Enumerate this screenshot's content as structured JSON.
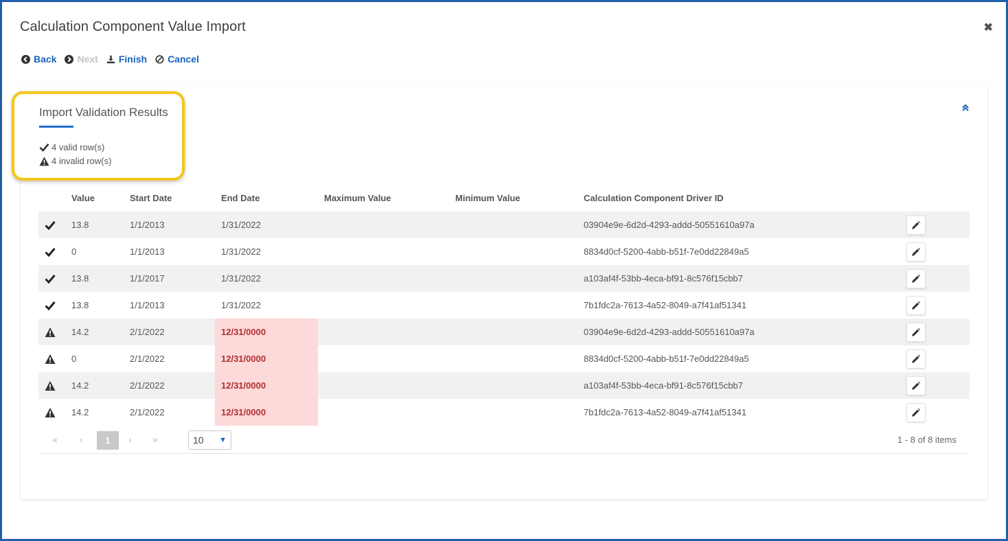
{
  "dialog": {
    "title": "Calculation Component Value Import",
    "close_icon": "close-icon"
  },
  "toolbar": {
    "back_label": "Back",
    "next_label": "Next",
    "finish_label": "Finish",
    "cancel_label": "Cancel"
  },
  "section": {
    "title": "Import Validation Results",
    "valid_rows": "4 valid row(s)",
    "invalid_rows": "4 invalid row(s)"
  },
  "colors": {
    "accent": "#1565c0",
    "frame_border": "#1f5fa8",
    "highlight": "#f3c61a",
    "error_bg": "#fdd9d9",
    "error_text": "#b03030"
  },
  "grid": {
    "columns": [
      "Value",
      "Start Date",
      "End Date",
      "Maximum Value",
      "Minimum Value",
      "Calculation Component Driver ID"
    ],
    "rows": [
      {
        "status": "valid",
        "value": "13.8",
        "start": "1/1/2013",
        "end": "1/31/2022",
        "max": "",
        "min": "",
        "driver": "03904e9e-6d2d-4293-addd-50551610a97a"
      },
      {
        "status": "valid",
        "value": "0",
        "start": "1/1/2013",
        "end": "1/31/2022",
        "max": "",
        "min": "",
        "driver": "8834d0cf-5200-4abb-b51f-7e0dd22849a5"
      },
      {
        "status": "valid",
        "value": "13.8",
        "start": "1/1/2017",
        "end": "1/31/2022",
        "max": "",
        "min": "",
        "driver": "a103af4f-53bb-4eca-bf91-8c576f15cbb7"
      },
      {
        "status": "valid",
        "value": "13.8",
        "start": "1/1/2013",
        "end": "1/31/2022",
        "max": "",
        "min": "",
        "driver": "7b1fdc2a-7613-4a52-8049-a7f41af51341"
      },
      {
        "status": "invalid",
        "value": "14.2",
        "start": "2/1/2022",
        "end": "12/31/0000",
        "max": "",
        "min": "",
        "driver": "03904e9e-6d2d-4293-addd-50551610a97a"
      },
      {
        "status": "invalid",
        "value": "0",
        "start": "2/1/2022",
        "end": "12/31/0000",
        "max": "",
        "min": "",
        "driver": "8834d0cf-5200-4abb-b51f-7e0dd22849a5"
      },
      {
        "status": "invalid",
        "value": "14.2",
        "start": "2/1/2022",
        "end": "12/31/0000",
        "max": "",
        "min": "",
        "driver": "a103af4f-53bb-4eca-bf91-8c576f15cbb7"
      },
      {
        "status": "invalid",
        "value": "14.2",
        "start": "2/1/2022",
        "end": "12/31/0000",
        "max": "",
        "min": "",
        "driver": "7b1fdc2a-7613-4a52-8049-a7f41af51341"
      }
    ]
  },
  "pager": {
    "current_page": "1",
    "page_size": "10",
    "info": "1 - 8 of 8 items",
    "first": "«",
    "prev": "‹",
    "next": "›",
    "last": "»"
  }
}
